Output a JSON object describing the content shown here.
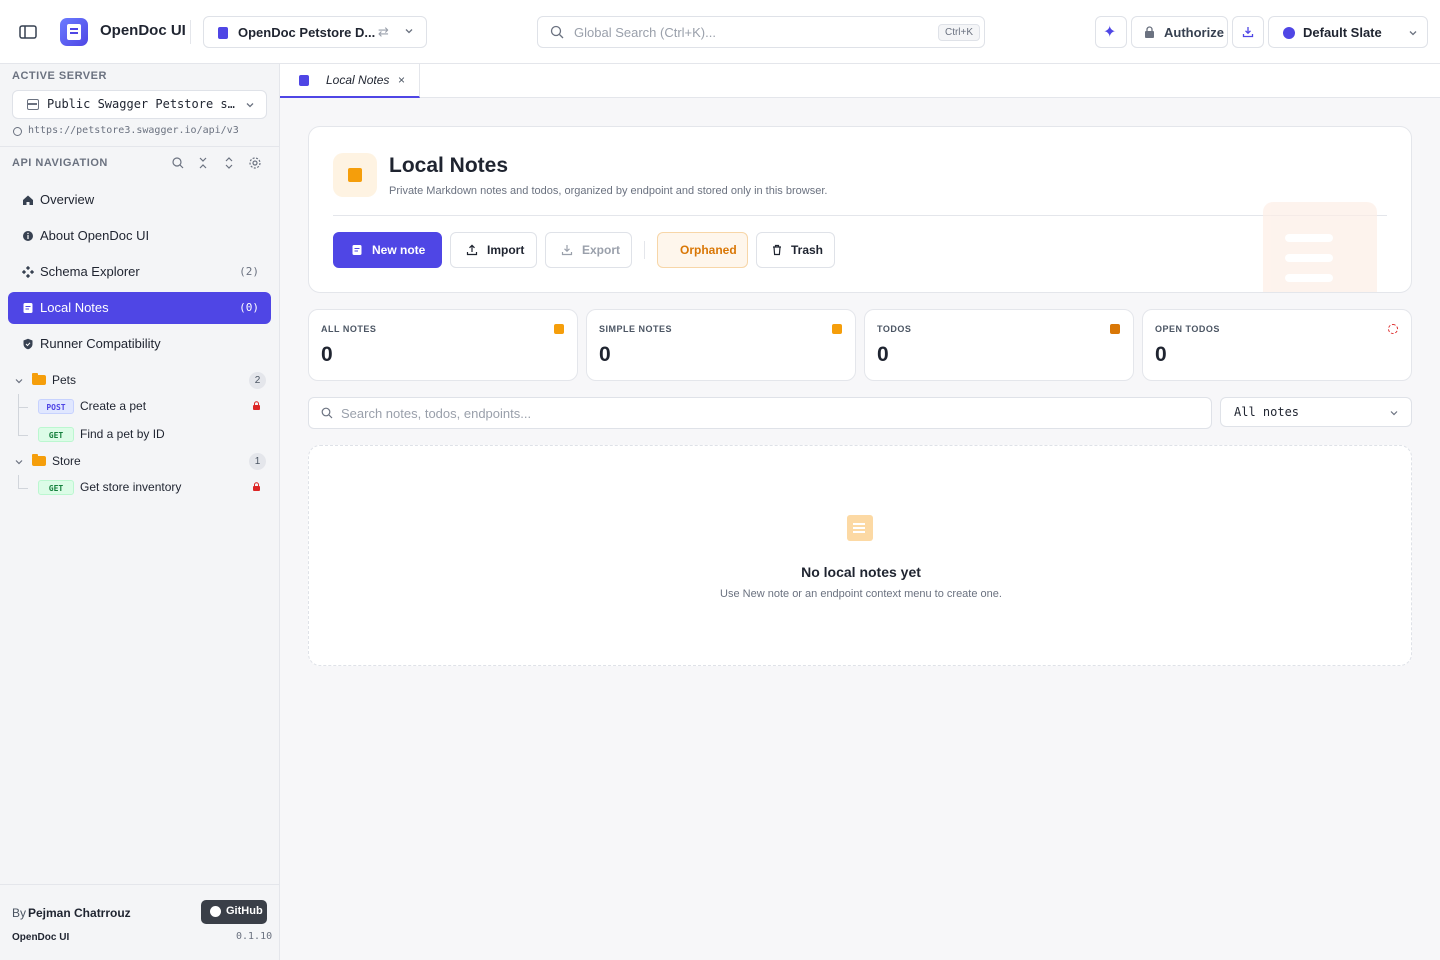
{
  "header": {
    "app_title": "OpenDoc UI",
    "spec_selector": "OpenDoc Petstore D...",
    "search_placeholder": "Global Search (Ctrl+K)...",
    "search_shortcut": "Ctrl+K",
    "authorize_label": "Authorize",
    "theme_label": "Default Slate"
  },
  "sidebar": {
    "active_server_label": "ACTIVE SERVER",
    "server_name": "Public Swagger Petstore s…",
    "server_url": "https://petstore3.swagger.io/api/v3",
    "api_nav_label": "API NAVIGATION",
    "nav_items": [
      {
        "label": "Overview",
        "count": ""
      },
      {
        "label": "About OpenDoc UI",
        "count": ""
      },
      {
        "label": "Schema Explorer",
        "count": "(2)"
      },
      {
        "label": "Local Notes",
        "count": "(0)"
      },
      {
        "label": "Runner Compatibility",
        "count": ""
      }
    ],
    "groups": [
      {
        "name": "Pets",
        "count": "2",
        "operations": [
          {
            "method": "POST",
            "label": "Create a pet",
            "locked": true
          },
          {
            "method": "GET",
            "label": "Find a pet by ID",
            "locked": false
          }
        ]
      },
      {
        "name": "Store",
        "count": "1",
        "operations": [
          {
            "method": "GET",
            "label": "Get store inventory",
            "locked": true
          }
        ]
      }
    ],
    "footer": {
      "by_label": "By",
      "author": "Pejman Chatrrouz",
      "github_label": "GitHub",
      "app_name": "OpenDoc UI",
      "version": "0.1.10"
    }
  },
  "tabs": [
    {
      "label": "Local Notes"
    }
  ],
  "main": {
    "title": "Local Notes",
    "subtitle": "Private Markdown notes and todos, organized by endpoint and stored only in this browser.",
    "buttons": {
      "new_note": "New note",
      "import": "Import",
      "export": "Export",
      "orphaned": "Orphaned",
      "trash": "Trash"
    },
    "stats": [
      {
        "label": "ALL NOTES",
        "value": "0"
      },
      {
        "label": "SIMPLE NOTES",
        "value": "0"
      },
      {
        "label": "TODOS",
        "value": "0"
      },
      {
        "label": "OPEN TODOS",
        "value": "0"
      }
    ],
    "search_placeholder": "Search notes, todos, endpoints...",
    "filter_value": "All notes",
    "empty_title": "No local notes yet",
    "empty_subtitle": "Use New note or an endpoint context menu to create one."
  },
  "colors": {
    "accent": "#4f46e5",
    "notes_orange": "#f59e0b",
    "lock_red": "#dc2626"
  }
}
